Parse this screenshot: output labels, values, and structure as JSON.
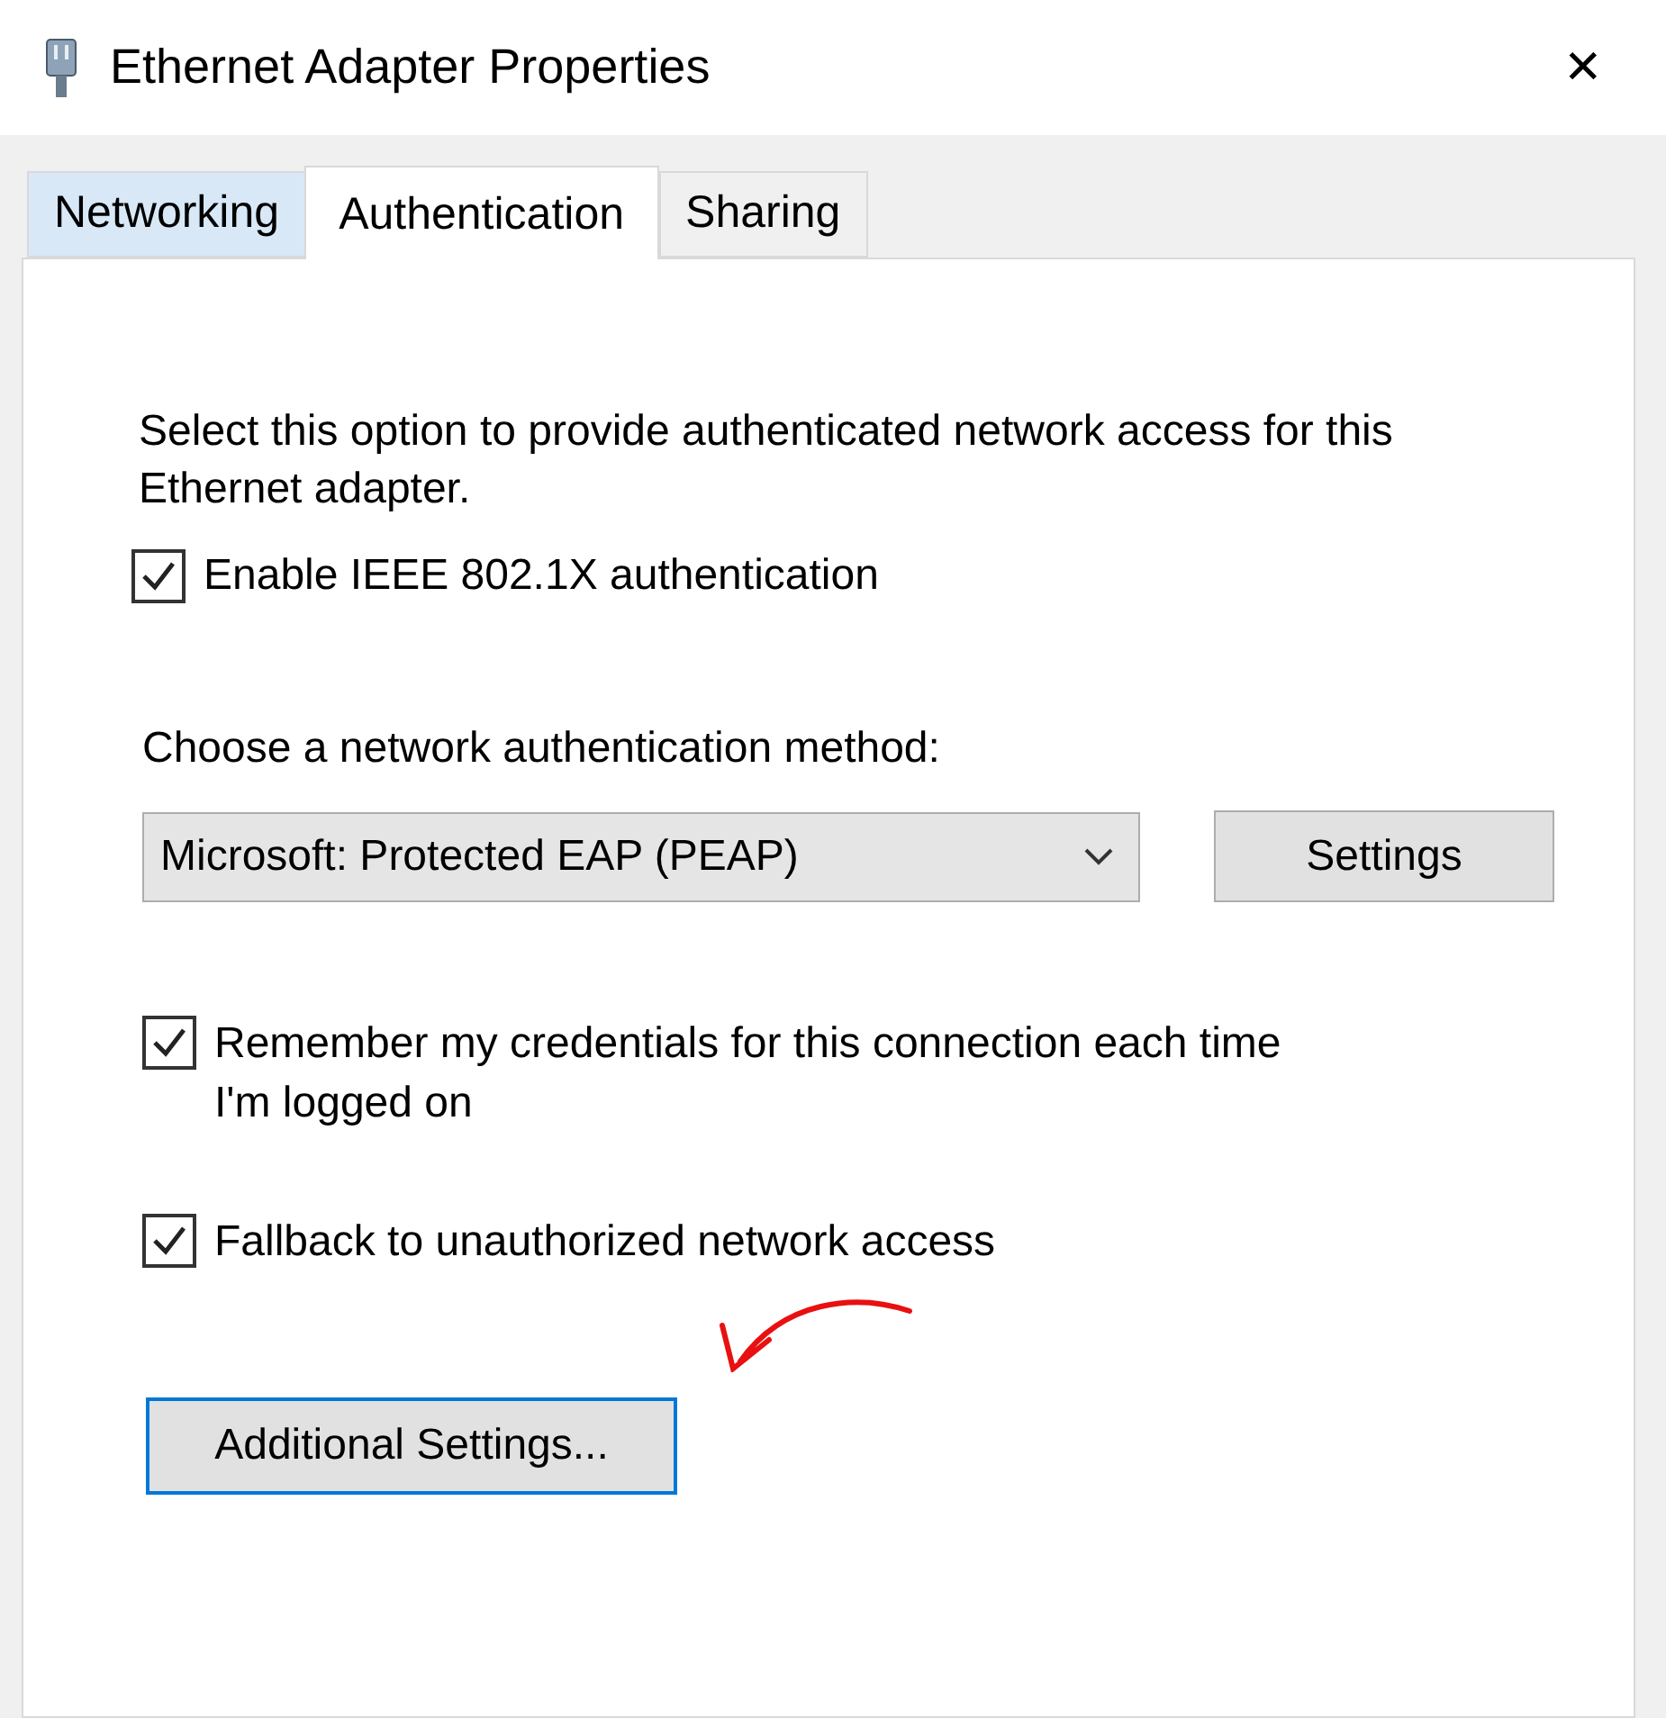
{
  "window": {
    "title": "Ethernet Adapter Properties",
    "close": "✕"
  },
  "tabs": [
    {
      "label": "Networking",
      "selected": false
    },
    {
      "label": "Authentication",
      "selected": true
    },
    {
      "label": "Sharing",
      "selected": false
    }
  ],
  "description": "Select this option to provide authenticated network access for this Ethernet adapter.",
  "enable_checkbox": {
    "label": "Enable IEEE 802.1X authentication",
    "checked": true
  },
  "method_label": "Choose a network authentication method:",
  "method_dropdown": {
    "value": "Microsoft: Protected EAP (PEAP)"
  },
  "settings_button": "Settings",
  "options": [
    {
      "label": "Remember my credentials for this connection each time I'm logged on",
      "checked": true
    },
    {
      "label": "Fallback to unauthorized network access",
      "checked": true
    }
  ],
  "additional_button": {
    "label": "Additional Settings...",
    "focused": true
  }
}
